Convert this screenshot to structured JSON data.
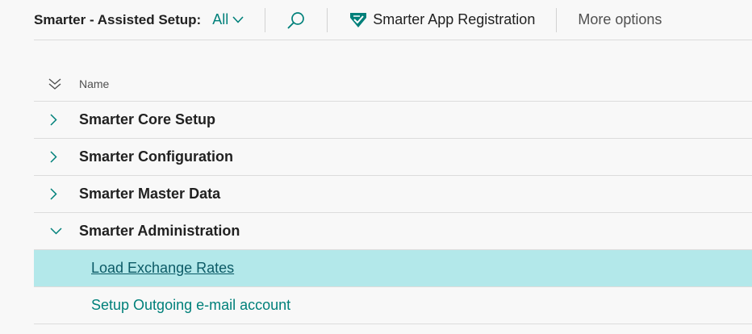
{
  "toolbar": {
    "caption": "Smarter - Assisted Setup:",
    "filter_label": "All",
    "app_registration_label": "Smarter App Registration",
    "more_options_label": "More options"
  },
  "grid": {
    "column_name": "Name",
    "groups": [
      {
        "label": "Smarter Core Setup",
        "expanded": false
      },
      {
        "label": "Smarter Configuration",
        "expanded": false
      },
      {
        "label": "Smarter Master Data",
        "expanded": false
      },
      {
        "label": "Smarter Administration",
        "expanded": true
      }
    ],
    "children": [
      {
        "label": "Load Exchange Rates",
        "selected": true
      },
      {
        "label": "Setup Outgoing e-mail account",
        "selected": false
      }
    ]
  },
  "colors": {
    "accent": "#00807a",
    "selected_row": "#b3e8ea",
    "background": "#f8f8f8"
  }
}
